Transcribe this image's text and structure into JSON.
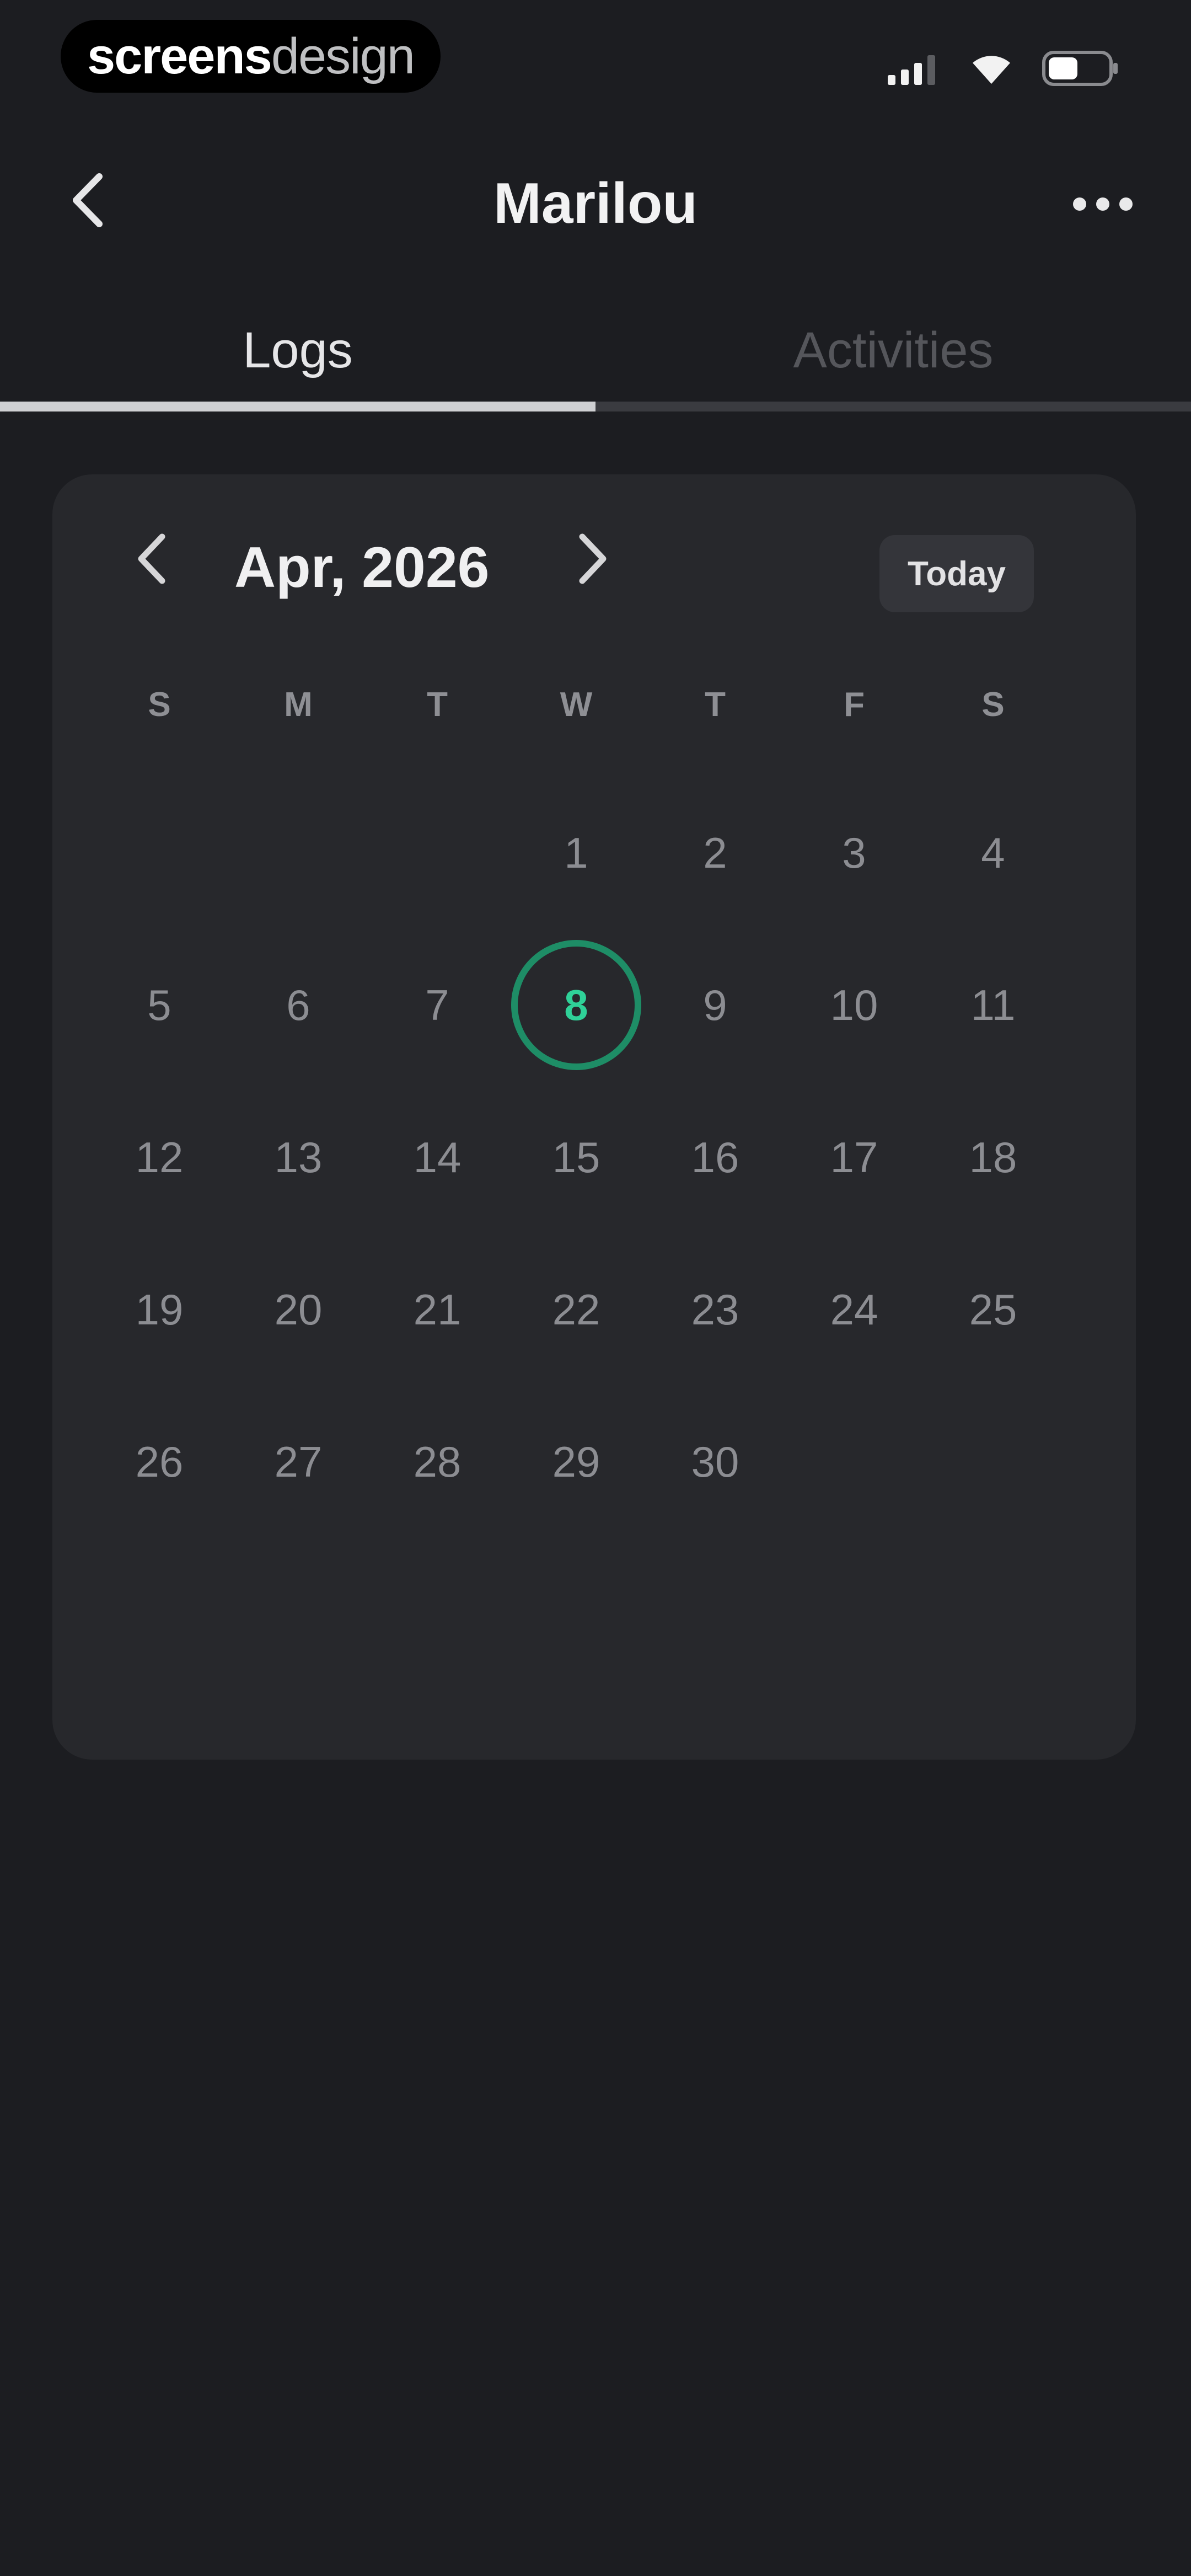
{
  "status_bar": {
    "brand_part1": "screens",
    "brand_part2": "design",
    "icons": [
      "cellular-signal-icon",
      "wifi-icon",
      "battery-icon"
    ]
  },
  "header": {
    "title": "Marilou",
    "back_icon": "chevron-left-icon",
    "more_icon": "more-horizontal-icon"
  },
  "tabs": {
    "items": [
      {
        "label": "Logs",
        "active": true
      },
      {
        "label": "Activities",
        "active": false
      }
    ]
  },
  "calendar": {
    "month_label": "Apr, 2026",
    "today_label": "Today",
    "weekdays": [
      "S",
      "M",
      "T",
      "W",
      "T",
      "F",
      "S"
    ],
    "leading_empty_days": 3,
    "days": [
      "1",
      "2",
      "3",
      "4",
      "5",
      "6",
      "7",
      "8",
      "9",
      "10",
      "11",
      "12",
      "13",
      "14",
      "15",
      "16",
      "17",
      "18",
      "19",
      "20",
      "21",
      "22",
      "23",
      "24",
      "25",
      "26",
      "27",
      "28",
      "29",
      "30"
    ],
    "selected_day": "8",
    "colors": {
      "selected_ring": "#1e8d66",
      "selected_text": "#2fd198"
    }
  }
}
